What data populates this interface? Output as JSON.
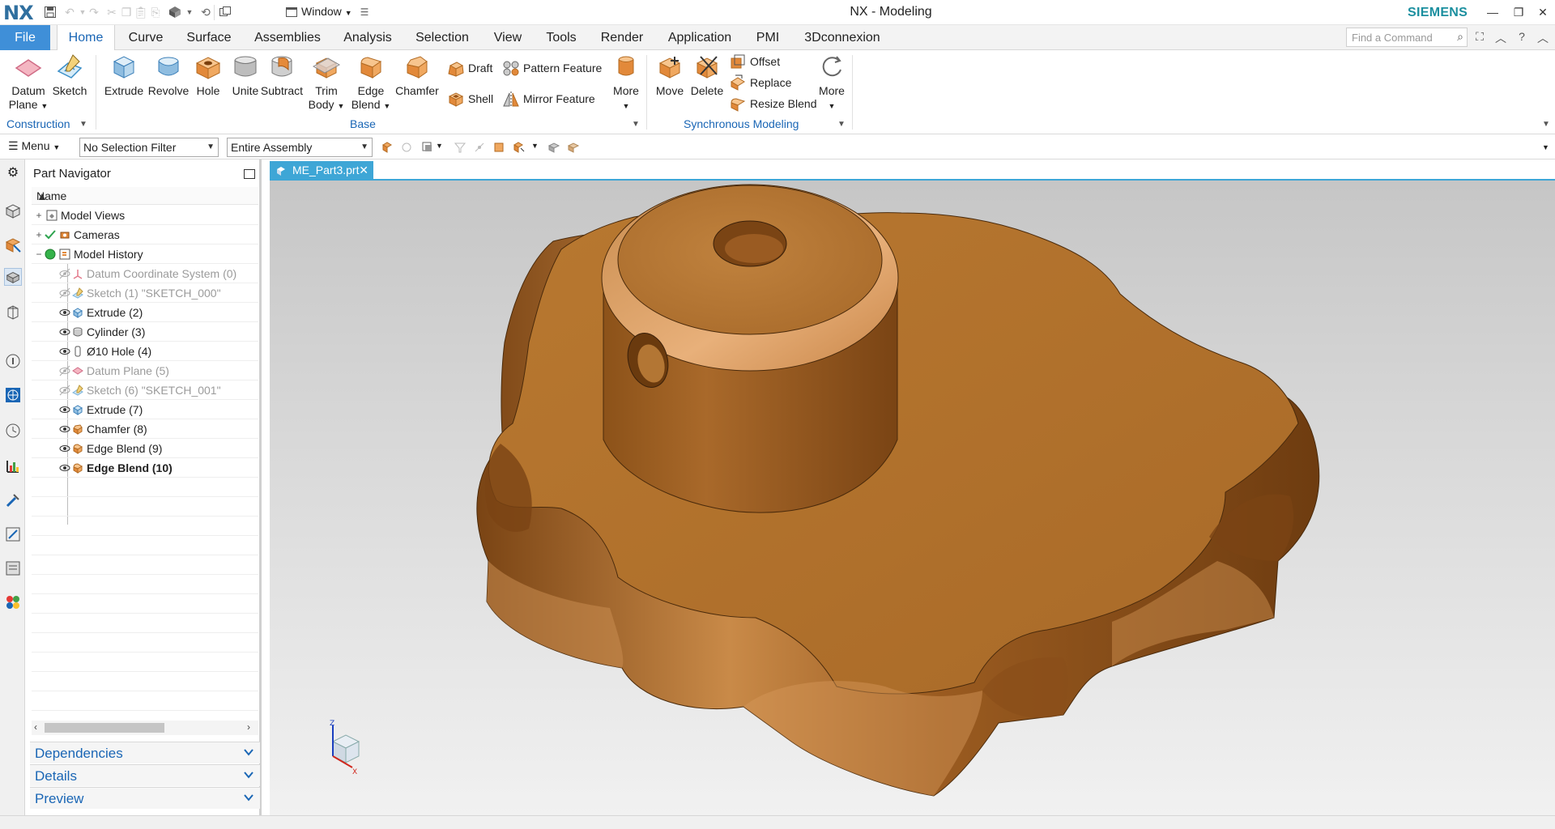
{
  "titlebar": {
    "logo": "NX",
    "window_label": "Window",
    "app_title": "NX - Modeling",
    "brand": "SIEMENS",
    "window_controls": [
      "minimize-icon",
      "restore-icon",
      "close-icon"
    ]
  },
  "tabs": [
    {
      "label": "File"
    },
    {
      "label": "Home"
    },
    {
      "label": "Curve"
    },
    {
      "label": "Surface"
    },
    {
      "label": "Assemblies"
    },
    {
      "label": "Analysis"
    },
    {
      "label": "Selection"
    },
    {
      "label": "View"
    },
    {
      "label": "Tools"
    },
    {
      "label": "Render"
    },
    {
      "label": "Application"
    },
    {
      "label": "PMI"
    },
    {
      "label": "3Dconnexion"
    }
  ],
  "find_command": {
    "placeholder": "Find a Command"
  },
  "ribbon": {
    "construction": {
      "group_label": "Construction",
      "datum_plane_1": "Datum",
      "datum_plane_2": "Plane",
      "sketch": "Sketch"
    },
    "base": {
      "group_label": "Base",
      "extrude": "Extrude",
      "revolve": "Revolve",
      "hole": "Hole",
      "unite": "Unite",
      "subtract": "Subtract",
      "trim_body_1": "Trim",
      "trim_body_2": "Body",
      "edge_blend_1": "Edge",
      "edge_blend_2": "Blend",
      "chamfer": "Chamfer",
      "draft": "Draft",
      "shell": "Shell",
      "pattern_feature": "Pattern Feature",
      "mirror_feature": "Mirror Feature",
      "more": "More"
    },
    "sync": {
      "group_label": "Synchronous Modeling",
      "move": "Move",
      "delete": "Delete",
      "offset": "Offset",
      "replace": "Replace",
      "resize_blend": "Resize Blend",
      "more": "More"
    }
  },
  "selection_bar": {
    "menu": "Menu",
    "filter": "No Selection Filter",
    "scope": "Entire Assembly"
  },
  "part_navigator": {
    "title": "Part Navigator",
    "column_name": "Name",
    "items": [
      {
        "label": "Model Views",
        "state": "normal"
      },
      {
        "label": "Cameras",
        "state": "normal"
      },
      {
        "label": "Model History",
        "state": "normal"
      },
      {
        "label": "Datum Coordinate System (0)",
        "state": "suppressed"
      },
      {
        "label": "Sketch (1) \"SKETCH_000\"",
        "state": "suppressed"
      },
      {
        "label": "Extrude (2)",
        "state": "normal"
      },
      {
        "label": "Cylinder (3)",
        "state": "normal"
      },
      {
        "label": "Ø10 Hole (4)",
        "state": "normal"
      },
      {
        "label": "Datum Plane (5)",
        "state": "suppressed"
      },
      {
        "label": "Sketch (6) \"SKETCH_001\"",
        "state": "suppressed"
      },
      {
        "label": "Extrude (7)",
        "state": "normal"
      },
      {
        "label": "Chamfer (8)",
        "state": "normal"
      },
      {
        "label": "Edge Blend (9)",
        "state": "normal"
      },
      {
        "label": "Edge Blend (10)",
        "state": "current"
      }
    ],
    "panels": [
      "Dependencies",
      "Details",
      "Preview"
    ]
  },
  "document": {
    "tab_label": "ME_Part3.prt"
  },
  "colors": {
    "accent": "#3f8fd8",
    "tab_highlight": "#3ea6d6",
    "brand": "#1b8f9f",
    "model_base": "#a9692a",
    "model_light": "#e0a46a",
    "model_dark": "#6e3e12"
  },
  "triad_labels": {
    "z": "Z",
    "x": "X"
  }
}
